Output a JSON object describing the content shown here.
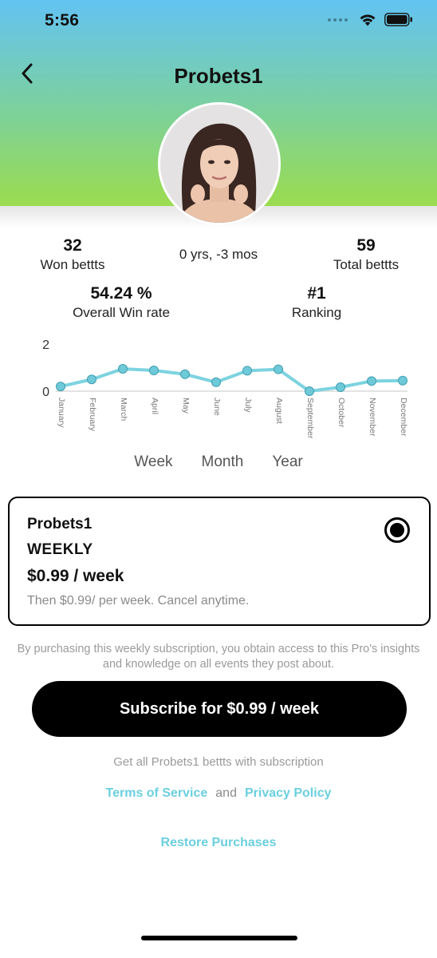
{
  "status_bar": {
    "time": "5:56"
  },
  "header": {
    "title": "Probets1"
  },
  "stats": {
    "won": {
      "value": "32",
      "label": "Won bettts"
    },
    "age": "0 yrs, -3 mos",
    "total": {
      "value": "59",
      "label": "Total bettts"
    },
    "win_rate": {
      "value": "54.24 %",
      "label": "Overall Win rate"
    },
    "ranking": {
      "value": "#1",
      "label": "Ranking"
    }
  },
  "chart_data": {
    "type": "line",
    "categories": [
      "January",
      "February",
      "March",
      "April",
      "May",
      "June",
      "July",
      "August",
      "September",
      "October",
      "November",
      "December"
    ],
    "values": [
      0.2,
      0.5,
      0.95,
      0.88,
      0.72,
      0.38,
      0.87,
      0.93,
      0.0,
      0.17,
      0.43,
      0.45
    ],
    "ylim": [
      0,
      2
    ],
    "yticks": [
      "0",
      "2"
    ],
    "line_color": "#7dd3e0",
    "marker_color": "#6ec9d8",
    "grid": false
  },
  "period_tabs": [
    "Week",
    "Month",
    "Year"
  ],
  "plan": {
    "name": "Probets1",
    "period": "WEEKLY",
    "price": "$0.99 / week",
    "description": "Then $0.99/ per week. Cancel anytime.",
    "selected": true
  },
  "disclaimer": "By purchasing this weekly subscription, you obtain access to this Pro's insights and knowledge on all events they post about.",
  "subscribe_button": "Subscribe for $0.99 / week",
  "sub_note": "Get all Probets1 bettts with subscription",
  "legal": {
    "terms": "Terms of Service",
    "and": "and",
    "privacy": "Privacy Policy"
  },
  "restore": "Restore Purchases",
  "colors": {
    "header_gradient_top": "#63c3f2",
    "header_gradient_bottom": "#9bdc4e",
    "link": "#6bcfe0",
    "button": "#000000"
  },
  "icons": {
    "back": "chevron-left-icon",
    "wifi": "wifi-icon",
    "battery": "battery-icon",
    "radio": "radio-selected-icon",
    "avatar": "avatar-photo"
  }
}
